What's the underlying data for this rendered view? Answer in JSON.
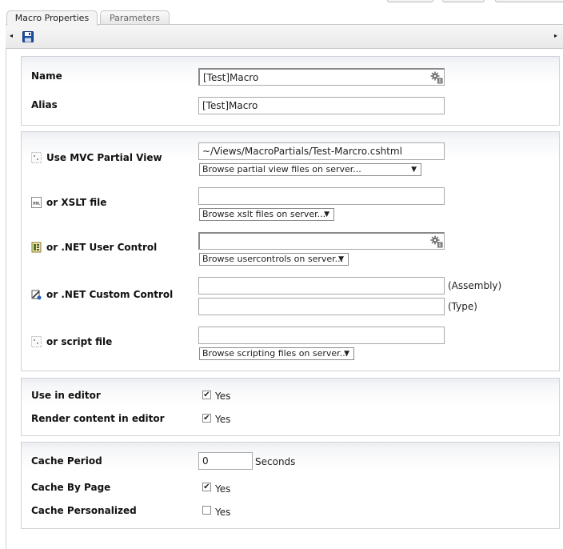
{
  "tabs": [
    {
      "label": "Macro Properties",
      "active": true
    },
    {
      "label": "Parameters",
      "active": false
    }
  ],
  "toolbar": {
    "left_arrow": "◂",
    "right_arrow": "▸",
    "save_icon": "floppy-disk-icon"
  },
  "general": {
    "name_label": "Name",
    "name_value": "[Test]Macro",
    "alias_label": "Alias",
    "alias_value": "[Test]Macro"
  },
  "render": {
    "mvc_label": "Use MVC Partial View",
    "mvc_value": "~/Views/MacroPartials/Test-Marcro.cshtml",
    "mvc_browse": "Browse partial view files on server...",
    "xslt_label": "or XSLT file",
    "xslt_value": "",
    "xslt_browse": "Browse xslt files on server...",
    "usercontrol_label": "or .NET User Control",
    "usercontrol_value": "",
    "usercontrol_browse": "Browse usercontrols on server...",
    "custom_label": "or .NET Custom Control",
    "assembly_value": "",
    "assembly_suffix": "(Assembly)",
    "type_value": "",
    "type_suffix": "(Type)",
    "script_label": "or script file",
    "script_value": "",
    "script_browse": "Browse scripting files on server..."
  },
  "editor": {
    "use_in_editor_label": "Use in editor",
    "use_in_editor_checked": true,
    "use_in_editor_text": "Yes",
    "render_content_label": "Render content in editor",
    "render_content_checked": true,
    "render_content_text": "Yes"
  },
  "cache": {
    "period_label": "Cache Period",
    "period_value": "0",
    "period_unit": "Seconds",
    "by_page_label": "Cache By Page",
    "by_page_checked": true,
    "by_page_text": "Yes",
    "personalized_label": "Cache Personalized",
    "personalized_checked": false,
    "personalized_text": "Yes"
  },
  "colors": {
    "panel_border": "#cfd2d8",
    "panel_header": "#eceef2",
    "toolbar_bg": "#e9e9e9",
    "save_blue": "#1d4fa3"
  }
}
